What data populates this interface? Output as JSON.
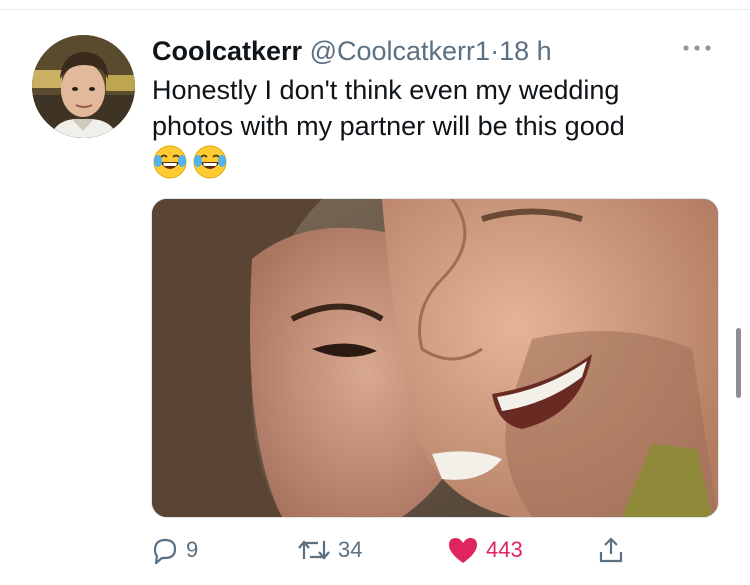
{
  "tweet": {
    "display_name": "Coolcatkerr",
    "handle": "@Coolcatkerr1",
    "separator": "·",
    "time": "18 h",
    "text": "Honestly I don't think even my wedding\nphotos with my partner will be this good",
    "emojis": [
      "face-with-tears-of-joy",
      "face-with-tears-of-joy"
    ]
  },
  "actions": {
    "reply_count": "9",
    "retweet_count": "34",
    "like_count": "443",
    "liked": true
  },
  "colors": {
    "text": "#0f1419",
    "secondary": "#5b7083",
    "like": "#e0245e",
    "divider": "#e6ecf0"
  },
  "icons": {
    "more": "more-dots-icon",
    "reply": "reply-icon",
    "retweet": "retweet-icon",
    "like": "heart-icon",
    "share": "share-icon"
  }
}
